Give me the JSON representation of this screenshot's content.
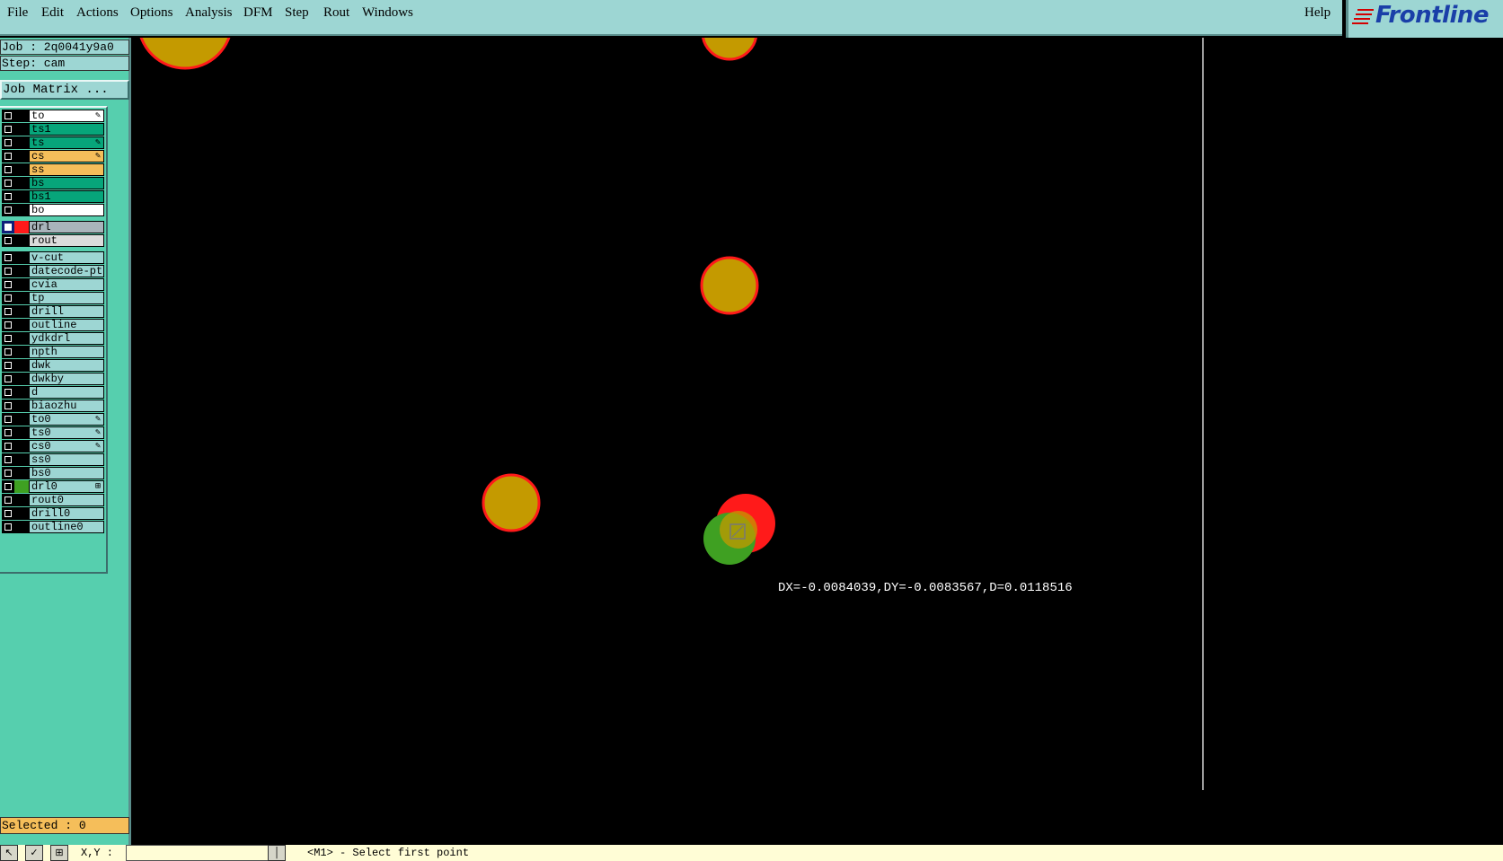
{
  "menubar": {
    "items": [
      "File",
      "Edit",
      "Actions",
      "Options",
      "Analysis",
      "DFM",
      "Step",
      "Rout",
      "Windows"
    ],
    "help": "Help"
  },
  "logo": {
    "text": "Frontline",
    "icon": "frontline-logo-icon"
  },
  "left_panel": {
    "job": "Job : 2q0041y9a0",
    "step": "Step: cam",
    "job_matrix": "Job Matrix ..."
  },
  "layers": [
    {
      "name": "to",
      "color": "#ffffff",
      "swatch": "#000000",
      "mark": "✎",
      "active": false
    },
    {
      "name": "ts1",
      "color": "#07a57a",
      "swatch": "#000000",
      "mark": "",
      "active": false
    },
    {
      "name": "ts",
      "color": "#07a57a",
      "swatch": "#000000",
      "mark": "✎",
      "active": false
    },
    {
      "name": "cs",
      "color": "#f5be5a",
      "swatch": "#000000",
      "mark": "✎",
      "active": false
    },
    {
      "name": "ss",
      "color": "#f5be5a",
      "swatch": "#000000",
      "mark": "",
      "active": false
    },
    {
      "name": "bs",
      "color": "#07a57a",
      "swatch": "#000000",
      "mark": "",
      "active": false
    },
    {
      "name": "bs1",
      "color": "#07a57a",
      "swatch": "#000000",
      "mark": "",
      "active": false
    },
    {
      "name": "bo",
      "color": "#ffffff",
      "swatch": "#000000",
      "mark": "",
      "active": false
    },
    {
      "name": "drl",
      "color": "#a9b4bb",
      "swatch": "#ff1a1a",
      "mark": "",
      "active": true
    },
    {
      "name": "rout",
      "color": "#dcdcdc",
      "swatch": "#000000",
      "mark": "",
      "active": false
    },
    {
      "name": "v-cut",
      "color": "#9dd6d3",
      "swatch": "#000000",
      "mark": "",
      "active": false
    },
    {
      "name": "datecode-ptc",
      "color": "#9dd6d3",
      "swatch": "#000000",
      "mark": "",
      "active": false
    },
    {
      "name": "cvia",
      "color": "#9dd6d3",
      "swatch": "#000000",
      "mark": "",
      "active": false
    },
    {
      "name": "tp",
      "color": "#9dd6d3",
      "swatch": "#000000",
      "mark": "",
      "active": false
    },
    {
      "name": "drill",
      "color": "#9dd6d3",
      "swatch": "#000000",
      "mark": "",
      "active": false
    },
    {
      "name": "outline",
      "color": "#9dd6d3",
      "swatch": "#000000",
      "mark": "",
      "active": false
    },
    {
      "name": "ydkdrl",
      "color": "#9dd6d3",
      "swatch": "#000000",
      "mark": "",
      "active": false
    },
    {
      "name": "npth",
      "color": "#9dd6d3",
      "swatch": "#000000",
      "mark": "",
      "active": false
    },
    {
      "name": "dwk",
      "color": "#9dd6d3",
      "swatch": "#000000",
      "mark": "",
      "active": false
    },
    {
      "name": "dwkby",
      "color": "#9dd6d3",
      "swatch": "#000000",
      "mark": "",
      "active": false
    },
    {
      "name": "d",
      "color": "#9dd6d3",
      "swatch": "#000000",
      "mark": "",
      "active": false
    },
    {
      "name": "biaozhu",
      "color": "#9dd6d3",
      "swatch": "#000000",
      "mark": "",
      "active": false
    },
    {
      "name": "to0",
      "color": "#9dd6d3",
      "swatch": "#000000",
      "mark": "✎",
      "active": false
    },
    {
      "name": "ts0",
      "color": "#9dd6d3",
      "swatch": "#000000",
      "mark": "✎",
      "active": false
    },
    {
      "name": "cs0",
      "color": "#9dd6d3",
      "swatch": "#000000",
      "mark": "✎",
      "active": false
    },
    {
      "name": "ss0",
      "color": "#9dd6d3",
      "swatch": "#000000",
      "mark": "",
      "active": false
    },
    {
      "name": "bs0",
      "color": "#9dd6d3",
      "swatch": "#000000",
      "mark": "",
      "active": false
    },
    {
      "name": "drl0",
      "color": "#9dd6d3",
      "swatch": "#3fa022",
      "mark": "⊞",
      "active": false
    },
    {
      "name": "rout0",
      "color": "#9dd6d3",
      "swatch": "#000000",
      "mark": "",
      "active": false
    },
    {
      "name": "drill0",
      "color": "#9dd6d3",
      "swatch": "#000000",
      "mark": "",
      "active": false
    },
    {
      "name": "outline0",
      "color": "#9dd6d3",
      "swatch": "#000000",
      "mark": "",
      "active": false
    }
  ],
  "selected": "Selected : 0",
  "measurement": "DX=-0.0084039,DY=-0.0083567,D=0.0118516",
  "statusbar": {
    "xy_label": "X,Y :",
    "xy_value": "",
    "prompt": "<M1> - Select first point"
  },
  "colors": {
    "menubar": "#9dd6d3",
    "panel": "#56cfae",
    "pad_fill": "#c49a00",
    "pad_outline": "#ff1a1a",
    "drl0_color": "#3fa022"
  }
}
